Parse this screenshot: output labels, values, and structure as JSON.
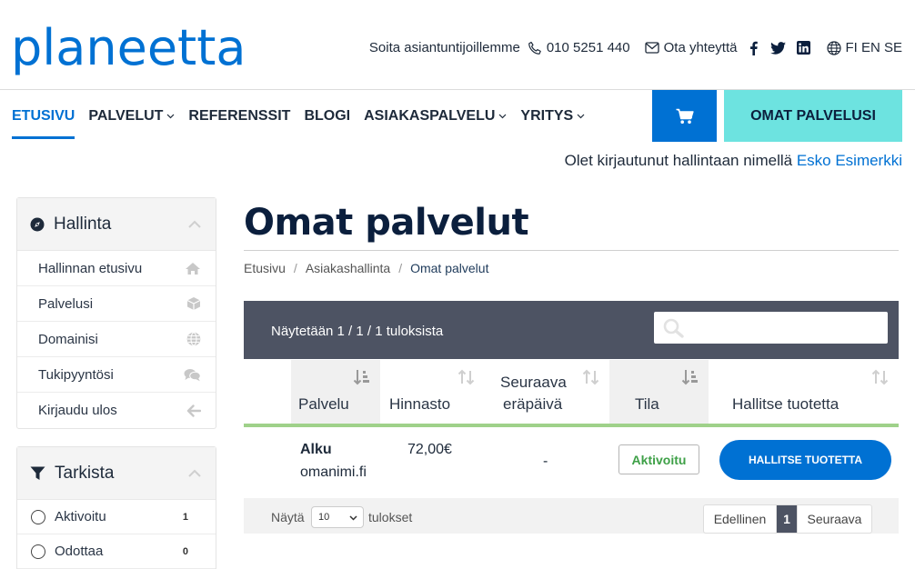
{
  "brand": {
    "logo_text": "planeetta",
    "color": "#0071d3"
  },
  "topbar": {
    "call_text": "Soita asiantuntijoillemme",
    "phone": "010 5251 440",
    "contact": "Ota yhteyttä",
    "languages": "FI EN SE"
  },
  "nav": {
    "items": [
      {
        "label": "ETUSIVU"
      },
      {
        "label": "PALVELUT"
      },
      {
        "label": "REFERENSSIT"
      },
      {
        "label": "BLOGI"
      },
      {
        "label": "ASIAKASPALVELU"
      },
      {
        "label": "YRITYS"
      }
    ],
    "my_services": "OMAT PALVELUSI"
  },
  "login": {
    "prefix": "Olet kirjautunut hallintaan nimellä",
    "user": "Esko Esimerkki"
  },
  "sidebar": {
    "admin_title": "Hallinta",
    "admin_items": [
      {
        "label": "Hallinnan etusivu",
        "icon": "home-icon"
      },
      {
        "label": "Palvelusi",
        "icon": "cube-icon"
      },
      {
        "label": "Domainisi",
        "icon": "globe-icon"
      },
      {
        "label": "Tukipyyntösi",
        "icon": "comments-icon"
      },
      {
        "label": "Kirjaudu ulos",
        "icon": "arrow-left-icon"
      }
    ],
    "filter_title": "Tarkista",
    "filters": [
      {
        "label": "Aktivoitu",
        "count": "1"
      },
      {
        "label": "Odottaa",
        "count": "0"
      }
    ]
  },
  "main": {
    "title": "Omat palvelut",
    "breadcrumb": [
      "Etusivu",
      "Asiakashallinta",
      "Omat palvelut"
    ],
    "table": {
      "info": "Näytetään 1 / 1 / 1 tuloksista",
      "search_placeholder": "",
      "headers": {
        "service": "Palvelu",
        "price": "Hinnasto",
        "due_1": "Seuraava",
        "due_2": "eräpäivä",
        "status": "Tila",
        "manage": "Hallitse tuotetta"
      },
      "rows": [
        {
          "name": "Alku",
          "domain": "omanimi.fi",
          "price": "72,00€",
          "due": "-",
          "status": "Aktivoitu",
          "action": "HALLITSE TUOTETTA"
        }
      ],
      "show_label": "Näytä",
      "show_value": "10",
      "show_suffix": "tulokset",
      "pager": {
        "prev": "Edellinen",
        "page": "1",
        "next": "Seuraava"
      }
    }
  },
  "colors": {
    "accent": "#0071d3",
    "teal": "#6de3e0",
    "dark_bar": "#4d5363",
    "active_green": "#3ea047"
  }
}
